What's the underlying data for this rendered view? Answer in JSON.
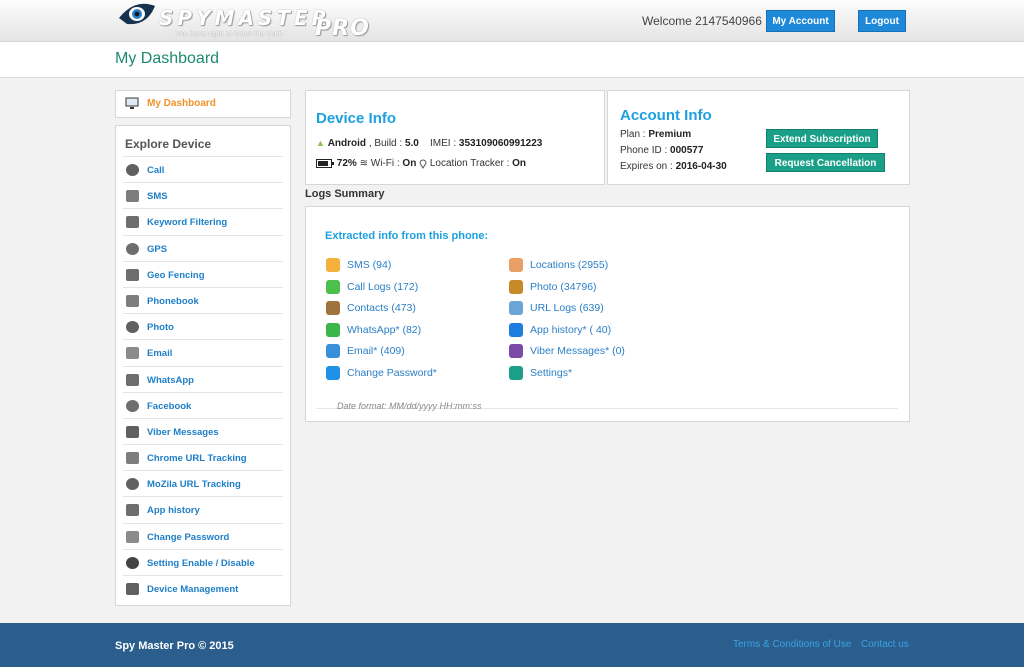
{
  "header": {
    "logo_text": "SPYMASTER",
    "logo_pro": "PRO",
    "tagline": "You have right to know the truth",
    "welcome": "Welcome 2147540966",
    "my_account": "My Account",
    "logout": "Logout"
  },
  "page": {
    "title": "My Dashboard"
  },
  "sidebar": {
    "dashboard": "My Dashboard",
    "explore_title": "Explore Device",
    "items": [
      {
        "label": "Call",
        "icon": "phone-icon"
      },
      {
        "label": "SMS",
        "icon": "sms-icon"
      },
      {
        "label": "Keyword Filtering",
        "icon": "keyword-icon"
      },
      {
        "label": "GPS",
        "icon": "map-pin-icon"
      },
      {
        "label": "Geo Fencing",
        "icon": "geofence-icon"
      },
      {
        "label": "Phonebook",
        "icon": "phonebook-icon"
      },
      {
        "label": "Photo",
        "icon": "photo-icon"
      },
      {
        "label": "Email",
        "icon": "email-icon"
      },
      {
        "label": "WhatsApp",
        "icon": "whatsapp-icon"
      },
      {
        "label": "Facebook",
        "icon": "facebook-icon"
      },
      {
        "label": "Viber Messages",
        "icon": "viber-icon"
      },
      {
        "label": "Chrome URL Tracking",
        "icon": "chrome-icon"
      },
      {
        "label": "MoZila URL Tracking",
        "icon": "firefox-icon"
      },
      {
        "label": "App history",
        "icon": "app-history-icon"
      },
      {
        "label": "Change Password",
        "icon": "password-icon"
      },
      {
        "label": "Setting Enable / Disable",
        "icon": "gear-icon"
      },
      {
        "label": "Device Management",
        "icon": "device-icon"
      }
    ]
  },
  "device": {
    "title": "Device Info",
    "os": "Android",
    "build_label": ", Build :",
    "build": "5.0",
    "imei_label": "IMEI :",
    "imei": "353109060991223",
    "battery": "72%",
    "wifi_label": "Wi-Fi :",
    "wifi": "On",
    "location_label": "Location Tracker :",
    "location": "On"
  },
  "account": {
    "title": "Account Info",
    "plan_label": "Plan :",
    "plan": "Premium",
    "phone_label": "Phone ID :",
    "phone_id": "000577",
    "expires_label": "Expires on :",
    "expires": "2016-04-30",
    "extend": "Extend Subscription",
    "cancel": "Request Cancellation"
  },
  "logs": {
    "title": "Logs Summary",
    "extracted": "Extracted info from this phone:",
    "left": [
      {
        "label": "SMS (94)",
        "icon": "sms-icon",
        "color": "#f5b13c"
      },
      {
        "label": "Call Logs (172)",
        "icon": "call-log-icon",
        "color": "#4cbf4c"
      },
      {
        "label": "Contacts (473)",
        "icon": "contacts-icon",
        "color": "#a0723c"
      },
      {
        "label": "WhatsApp* (82)",
        "icon": "whatsapp-icon",
        "color": "#3cb54a"
      },
      {
        "label": "Email* (409)",
        "icon": "email-icon",
        "color": "#3a8fdb"
      },
      {
        "label": "Change Password*",
        "icon": "lock-icon",
        "color": "#1e90e6"
      }
    ],
    "right": [
      {
        "label": "Locations (2955)",
        "icon": "locations-icon",
        "color": "#e8a066"
      },
      {
        "label": "Photo (34796)",
        "icon": "photo-icon",
        "color": "#c78a2a"
      },
      {
        "label": "URL Logs (639)",
        "icon": "url-icon",
        "color": "#6aa6d8"
      },
      {
        "label": "App history* ( 40)",
        "icon": "dropbox-icon",
        "color": "#1e7ee0"
      },
      {
        "label": "Viber Messages* (0)",
        "icon": "viber-icon",
        "color": "#7b4aa8"
      },
      {
        "label": "Settings*",
        "icon": "gear-icon",
        "color": "#1aa088"
      }
    ],
    "date_format": "Date format: MM/dd/yyyy HH:mm:ss"
  },
  "footer": {
    "copyright": "Spy Master Pro © 2015",
    "terms": "Terms & Conditions of Use",
    "contact": "Contact us"
  }
}
